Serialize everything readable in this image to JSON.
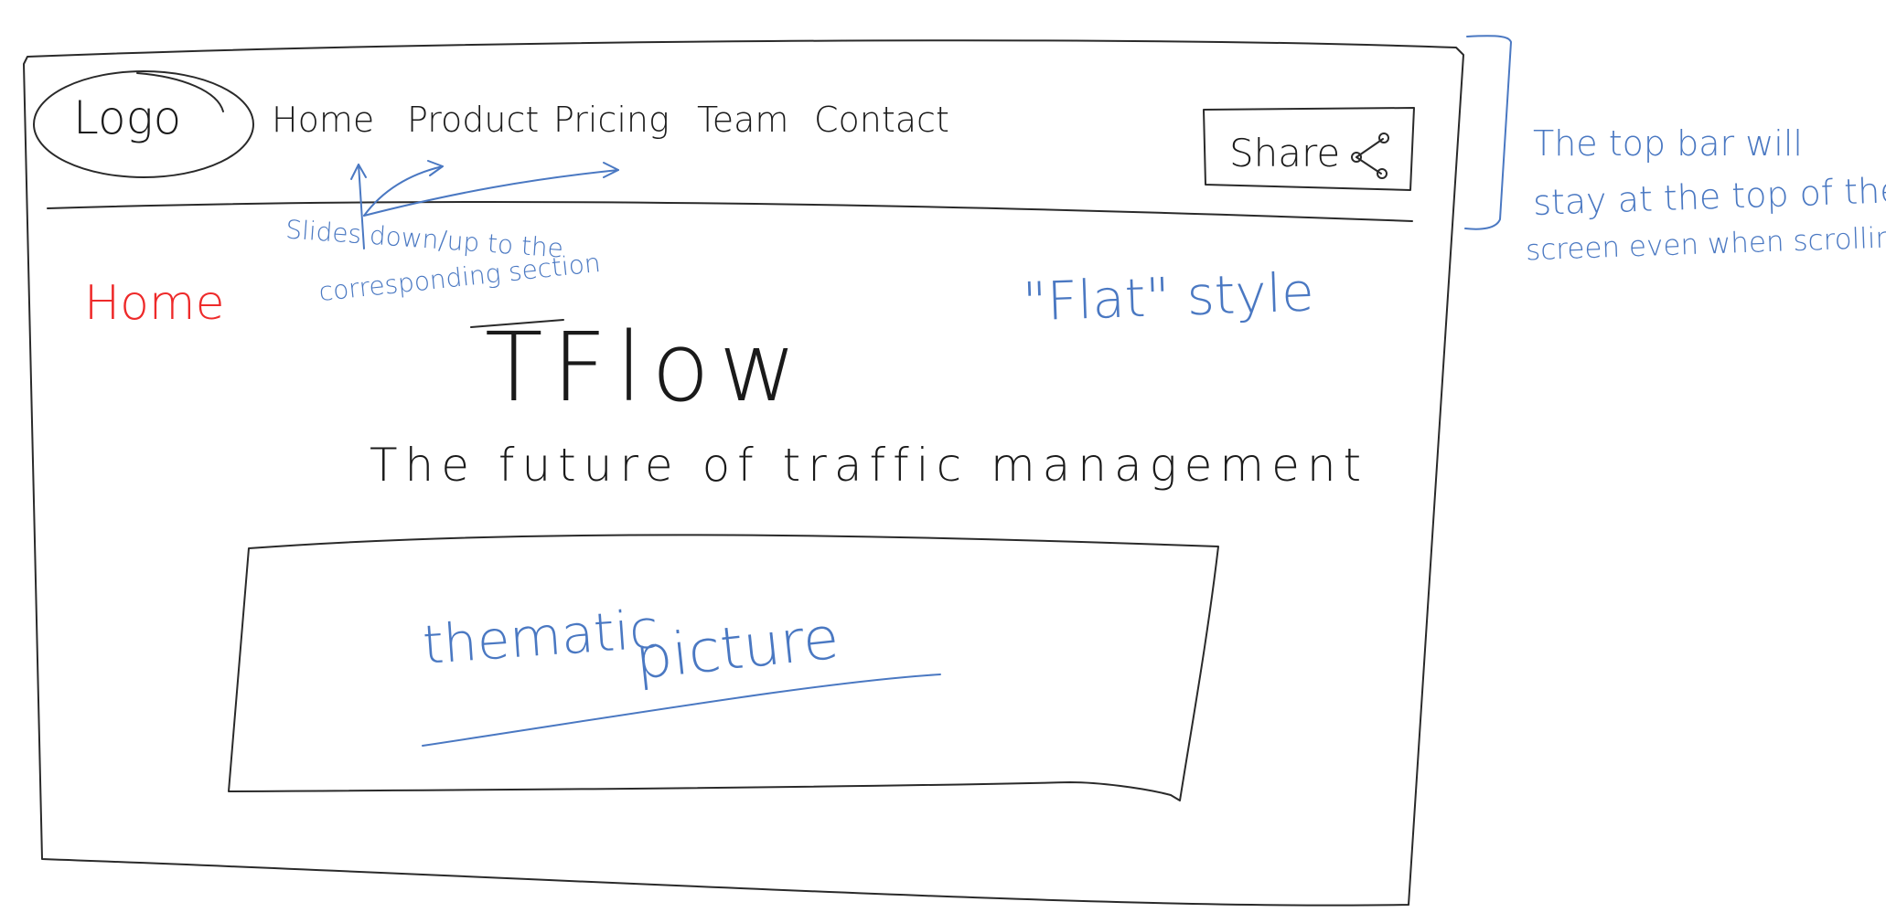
{
  "header": {
    "logo": "Logo",
    "nav": [
      "Home",
      "Product",
      "Pricing",
      "Team",
      "Contact"
    ],
    "share_label": "Share",
    "share_icon": "share-icon"
  },
  "annotations": {
    "nav_slide_line1": "Slides down/up to the",
    "nav_slide_line2": "corresponding section",
    "section_label": "Home",
    "style_note": "\"Flat\" style",
    "sticky_line1": "The top bar will",
    "sticky_line2": "stay at the top of the",
    "sticky_line3": "screen even when scrolling"
  },
  "hero": {
    "title": "TFlow",
    "tagline": "The future of traffic management",
    "picture_word1": "thematic",
    "picture_word2": "picture"
  },
  "colors": {
    "ink": "#2a2a2a",
    "annotation_blue": "#4a78c2",
    "section_red": "#ee2a2a"
  }
}
